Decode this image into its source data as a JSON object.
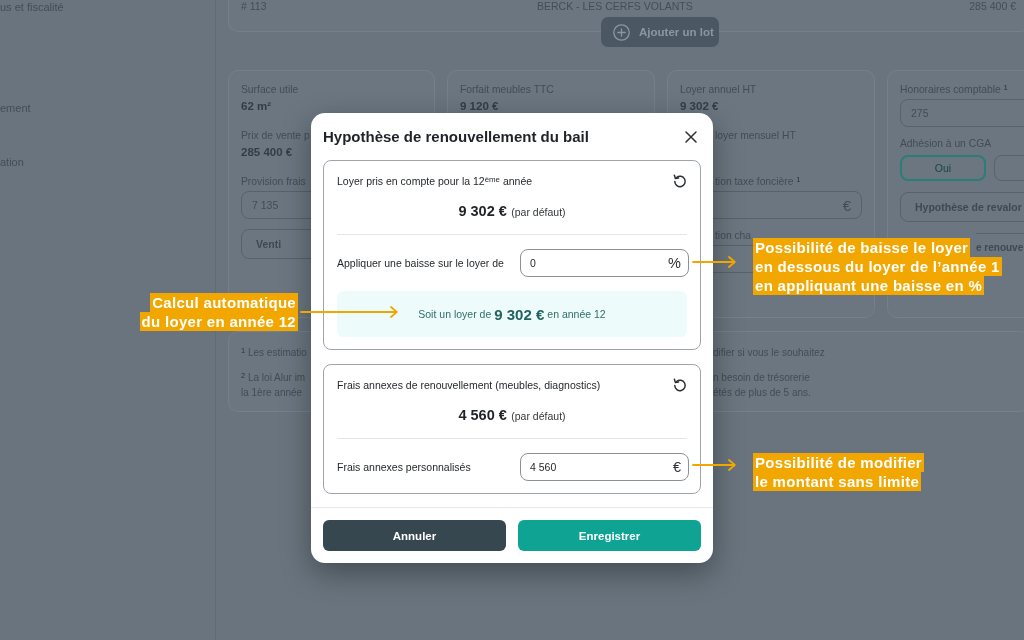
{
  "sidebar": {
    "items": [
      "us et fiscalité",
      "ement",
      "ation"
    ]
  },
  "lot_row": {
    "number": "# 113",
    "name": "BERCK - LES CERFS VOLANTS",
    "price": "285 400 €"
  },
  "add_lot_button": {
    "label": "Ajouter un lot"
  },
  "cards": [
    {
      "groups": [
        {
          "kind": "value",
          "label": "Surface utile",
          "value": "62 m²"
        },
        {
          "kind": "value",
          "label": "Prix de vente p",
          "value": "285 400 €"
        },
        {
          "kind": "field",
          "label": "Provision frais",
          "value": "7 135"
        },
        {
          "kind": "button",
          "text": "Venti"
        }
      ]
    },
    {
      "groups": [
        {
          "kind": "value",
          "label": "Forfait meubles TTC",
          "value": "9 120 €"
        }
      ]
    },
    {
      "groups": [
        {
          "kind": "value",
          "label": "Loyer annuel HT",
          "value": "9 302 €"
        },
        {
          "kind": "covered",
          "label_tail": "loyer mensuel HT"
        },
        {
          "kind": "field",
          "label_tail": "tion taxe foncière $^{1}$",
          "suffix": "€"
        },
        {
          "kind": "field",
          "label_tail": "tion cha"
        }
      ]
    },
    {
      "groups": [
        {
          "kind": "field",
          "label": "Honoraires comptable $^{1}$",
          "value": "275"
        },
        {
          "kind": "toggles",
          "label": "Adhésion à un CGA",
          "options": [
            {
              "label": "Oui",
              "selected": true
            },
            {
              "selected": false
            }
          ]
        },
        {
          "kind": "button",
          "text": "Hypothèse de revalor"
        },
        {
          "kind": "button",
          "text_tail": "e renouve"
        }
      ]
    }
  ],
  "footnotes": [
    {
      "left": [
        "$^{1}$ Les estimatio"
      ],
      "right": [
        "difier si vous le souhaitez"
      ]
    },
    {
      "left": [
        "$^{2}$ La loi Alur im",
        "la 1ère année"
      ],
      "right": [
        "n besoin de trésorerie",
        "étés de plus de 5 ans."
      ]
    }
  ],
  "dialog": {
    "title": "Hypothèse de renouvellement du bail",
    "sections": [
      {
        "heading": "Loyer pris en compte pour la 12$^{ème}$ année",
        "default_amount": "9 302 €",
        "default_note": "(par défaut)",
        "field": {
          "label": "Appliquer une baisse sur le loyer de",
          "value": "0",
          "suffix": "%"
        },
        "result": "Soit un loyer de **9 302 €** en année 12"
      },
      {
        "heading": "Frais annexes de renouvellement (meubles, diagnostics)",
        "default_amount": "4 560 €",
        "default_note": "(par défaut)",
        "field": {
          "label": "Frais annexes personnalisés",
          "value": "4 560",
          "suffix": "€"
        }
      }
    ],
    "buttons": [
      {
        "label": "Annuler",
        "kind": "secondary"
      },
      {
        "label": "Enregistrer",
        "kind": "primary"
      }
    ]
  },
  "callouts": [
    {
      "kind": "left",
      "lines": [
        "Calcul automatique",
        "du loyer en année 12"
      ]
    },
    {
      "kind": "right",
      "lines": [
        "Possibilité de baisse le loyer",
        "en dessous du loyer de l’année 1",
        "en appliquant une baisse en %"
      ]
    },
    {
      "kind": "right",
      "lines": [
        "Possibilité de modifier",
        "le montant sans limite"
      ]
    }
  ]
}
